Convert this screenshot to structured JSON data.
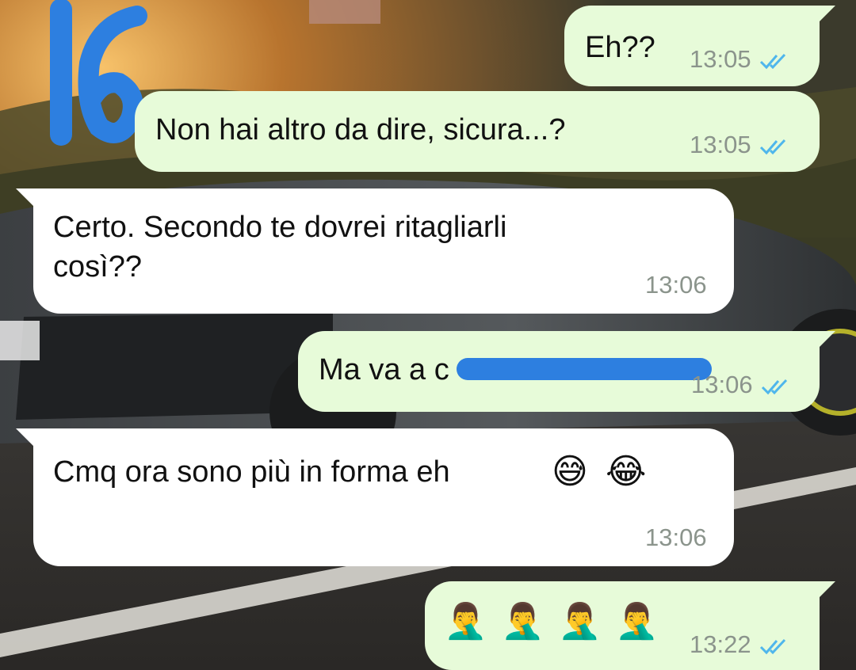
{
  "overlay": {
    "number": "16",
    "color": "#2d7fe0"
  },
  "colors": {
    "outgoing": "#e7fbd9",
    "incoming": "#ffffff",
    "ticks": "#4fb6ec",
    "time": "#8b948c"
  },
  "messages": [
    {
      "id": "m1",
      "direction": "outgoing",
      "text": "Eh??",
      "time": "13:05",
      "status": "read"
    },
    {
      "id": "m2",
      "direction": "outgoing",
      "text": "Non hai altro da dire, sicura...?",
      "time": "13:05",
      "status": "read"
    },
    {
      "id": "m3",
      "direction": "incoming",
      "text": "Certo. Secondo te dovrei ritagliarli\ncosì??",
      "time": "13:06"
    },
    {
      "id": "m4",
      "direction": "outgoing",
      "text": "Ma va a c",
      "redacted": true,
      "time": "13:06",
      "status": "read"
    },
    {
      "id": "m5",
      "direction": "incoming",
      "text": "Cmq ora sono più in forma eh",
      "emojis": [
        "😅",
        "😂"
      ],
      "time": "13:06"
    },
    {
      "id": "m6",
      "direction": "outgoing",
      "text": "",
      "emojis": [
        "🤦‍♂️",
        "🤦‍♂️",
        "🤦‍♂️",
        "🤦‍♂️"
      ],
      "emoji_names": [
        "man-facepalming-icon"
      ],
      "time": "13:22",
      "status": "read"
    }
  ]
}
